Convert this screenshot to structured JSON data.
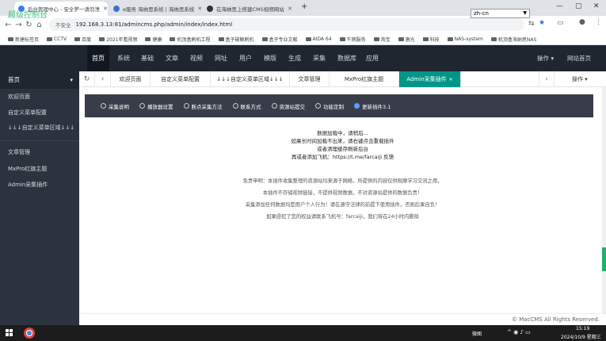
{
  "browser": {
    "tabs": [
      {
        "title": "后台管理中心 - 安全第一请勿泄",
        "active": true,
        "icon_color": "#3a7afe"
      },
      {
        "title": "e服务 海纳思系统 | 海纳思系统",
        "active": false,
        "icon_color": "#3b6fd6"
      },
      {
        "title": "在海纳思上搭建CMS视频网站",
        "active": false,
        "icon_color": "#333333"
      }
    ],
    "new_tab_icon": "plus-icon",
    "window_controls": [
      "minimize-icon",
      "restore-icon",
      "close-icon"
    ],
    "security_label": "不安全",
    "url": "192.168.3.13:81/admincms.php/admin/index/index.html",
    "bookmarks": [
      "新建标签页",
      "CCTV",
      "百度",
      "2021年看视频",
      "健康",
      "机顶盒刷机工程",
      "盒子破解刷机",
      "盒子专业文献",
      "AIDA 64",
      "牛网服务",
      "淘宝",
      "激光",
      "科技",
      "NAS-system",
      "机顶盒海纳思NAS"
    ]
  },
  "app": {
    "logo": "超级控制台",
    "menu_icon": "dots-icon",
    "nav": [
      "首页",
      "系统",
      "基础",
      "文章",
      "视频",
      "网址",
      "用户",
      "模版",
      "生成",
      "采集",
      "数据库",
      "应用"
    ],
    "nav_active": "首页",
    "language": "zh-cn",
    "header_links": [
      "操作 ▾",
      "网站首页"
    ],
    "accent": "#009688",
    "sidebar": {
      "header": "首页",
      "groups": [
        [
          "欢迎页面",
          "自定义菜单配置",
          "↓↓↓自定义菜单区域↓↓↓"
        ],
        [
          "文章管理",
          "MxPro红旗主题",
          "Admin采集插件"
        ]
      ]
    },
    "content_tabs": [
      "欢迎页面",
      "自定义菜单配置",
      "↓↓↓自定义菜单区域↓↓↓",
      "文章管理",
      "MxPro红旗主题",
      "Admin采集插件"
    ],
    "content_tab_active": "Admin采集插件",
    "content_ops": "操作 ▾",
    "toolbar": [
      "采集说明",
      "播放器设置",
      "断点采集方法",
      "联系方式",
      "资源站提交",
      "功能定制",
      "更新插件3.1"
    ],
    "messages": [
      "数据加载中，请稍后...",
      "如果长时间加载不出来，请右键点击重载插件",
      "或者清理缓存刷新后台",
      "再或者添加飞机：https://t.me/farcaiji 反馈"
    ],
    "notes": [
      "免责申明：本插件收集整理的资源站均来源于网络，所提供的内容仅供观摩学习交流之用，",
      "本插件不存储视频链接，不提供视频数据，不对资源站提供的数据负责！",
      "采集添加任何数据均是用户个人行为！请在遵守法律的前提下使用插件，否则后果自负！",
      "如果侵犯了您的权益请联系飞机号：farcaiji，我们将在24小时内删除"
    ],
    "footer": "© MacCMS All Rights Reserved."
  },
  "taskbar": {
    "tray_text": "微图",
    "time": "15:19",
    "date": "2024/10/9 星期三"
  }
}
